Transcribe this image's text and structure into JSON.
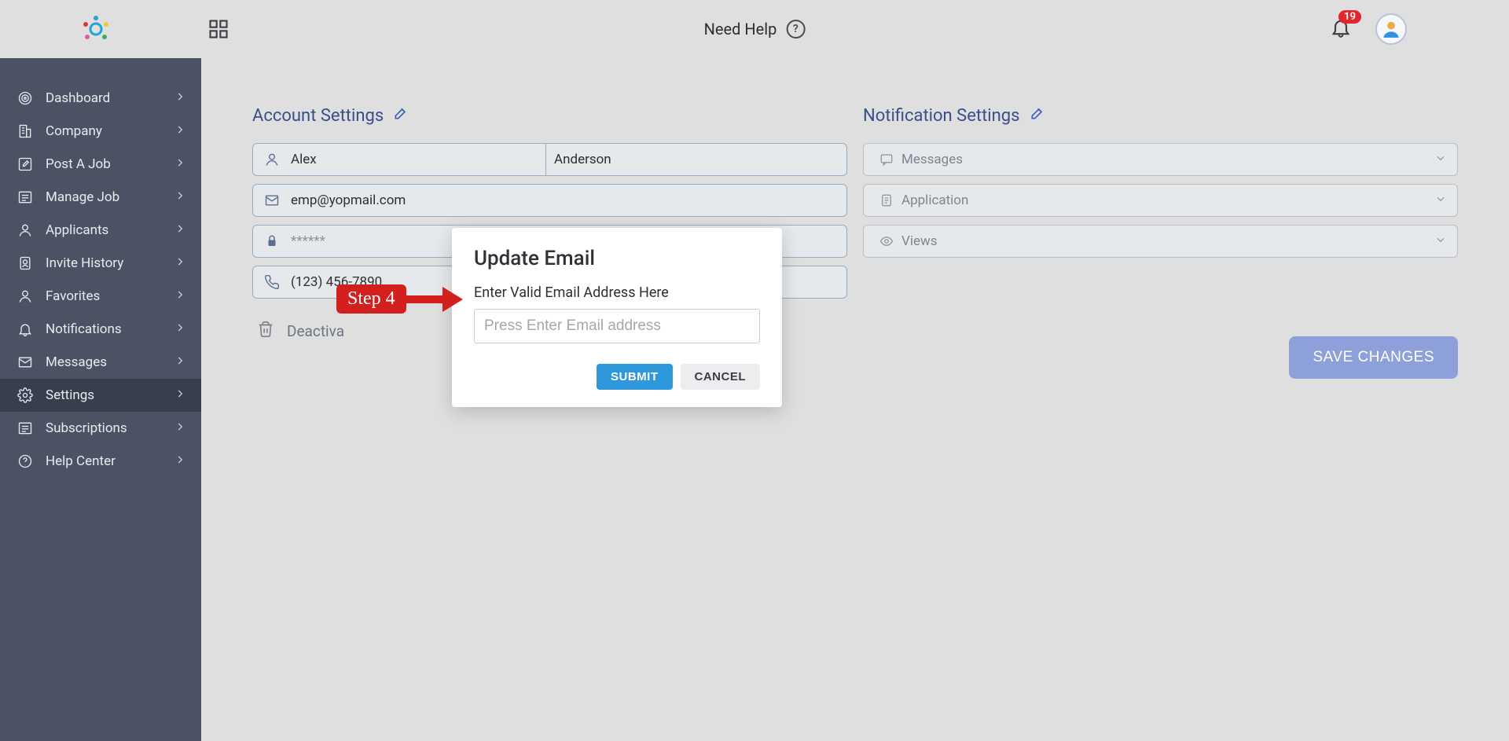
{
  "header": {
    "need_help": "Need Help",
    "notification_count": "19"
  },
  "sidebar": {
    "items": [
      {
        "label": "Dashboard"
      },
      {
        "label": "Company"
      },
      {
        "label": "Post A Job"
      },
      {
        "label": "Manage Job"
      },
      {
        "label": "Applicants"
      },
      {
        "label": "Invite History"
      },
      {
        "label": "Favorites"
      },
      {
        "label": "Notifications"
      },
      {
        "label": "Messages"
      },
      {
        "label": "Settings"
      },
      {
        "label": "Subscriptions"
      },
      {
        "label": "Help Center"
      }
    ],
    "active_index": 9
  },
  "account_settings": {
    "title": "Account Settings",
    "first_name": "Alex",
    "last_name": "Anderson",
    "email": "emp@yopmail.com",
    "password_masked": "******",
    "phone": "(123) 456-7890",
    "deactivate": "Deactiva"
  },
  "notification_settings": {
    "title": "Notification Settings",
    "items": [
      "Messages",
      "Application",
      "Views"
    ]
  },
  "save_button": "SAVE CHANGES",
  "modal": {
    "title": "Update Email",
    "label": "Enter Valid Email Address Here",
    "placeholder": "Press Enter Email address",
    "submit": "SUBMIT",
    "cancel": "CANCEL"
  },
  "annotation": {
    "step_label": "Step 4"
  }
}
